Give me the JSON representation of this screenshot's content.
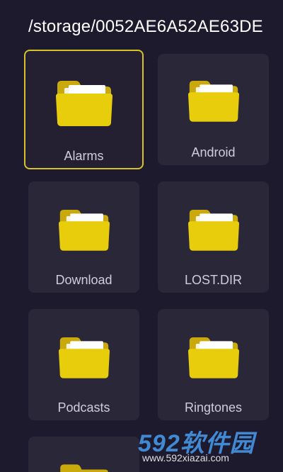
{
  "header": {
    "path": "/storage/0052AE6A52AE63DE"
  },
  "folders": [
    {
      "name": "Alarms",
      "selected": true
    },
    {
      "name": "Android",
      "selected": false
    },
    {
      "name": "Download",
      "selected": false
    },
    {
      "name": "LOST.DIR",
      "selected": false
    },
    {
      "name": "Podcasts",
      "selected": false
    },
    {
      "name": "Ringtones",
      "selected": false
    }
  ],
  "icons": {
    "folder": "folder-icon"
  },
  "colors": {
    "background": "#1d1a2e",
    "tile": "#2a2738",
    "selection_border": "#d8c12a",
    "folder_yellow": "#e8cd0c",
    "folder_back": "#c9a90c"
  },
  "watermark": {
    "brand": "592软件园",
    "url": "www.592xiazai.com"
  }
}
